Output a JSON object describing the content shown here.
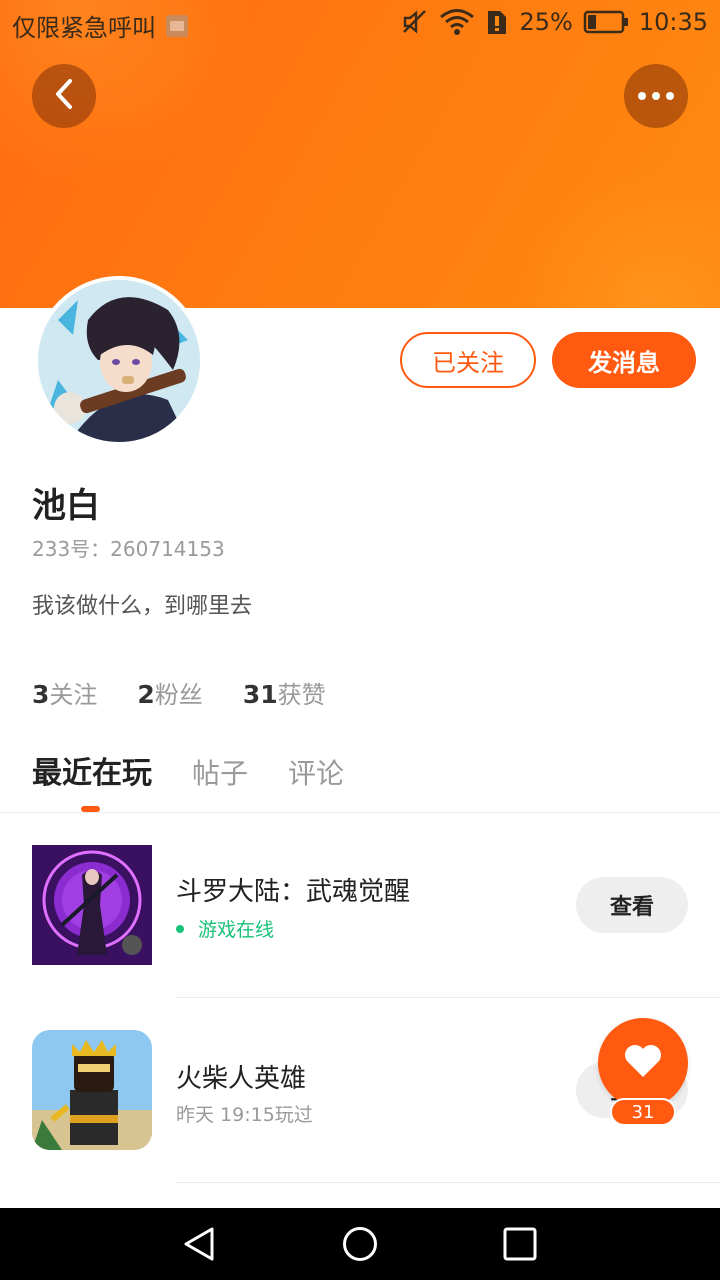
{
  "status_bar": {
    "carrier_text": "仅限紧急呼叫",
    "battery_percent": "25%",
    "time": "10:35",
    "battery_level": 0.25
  },
  "header": {
    "back_icon": "chevron-left-icon",
    "more_icon": "more-dots-icon",
    "accent_color": "#ff5a10"
  },
  "profile": {
    "name": "池白",
    "uid": "233号：260714153",
    "bio": "我该做什么，到哪里去",
    "follow_label": "已关注",
    "message_label": "发消息"
  },
  "stats": [
    {
      "count": "3",
      "label": "关注"
    },
    {
      "count": "2",
      "label": "粉丝"
    },
    {
      "count": "31",
      "label": "获赞"
    }
  ],
  "tabs": [
    {
      "label": "最近在玩",
      "active": true
    },
    {
      "label": "帖子",
      "active": false
    },
    {
      "label": "评论",
      "active": false
    }
  ],
  "games": [
    {
      "title": "斗罗大陆：武魂觉醒",
      "status": "游戏在线",
      "status_color": "#19c37a",
      "button": "查看"
    },
    {
      "title": "火柴人英雄",
      "status": "昨天 19:15玩过",
      "status_color": "#9a9a9a",
      "button": "查看"
    }
  ],
  "like": {
    "count": "31",
    "icon": "heart-icon"
  },
  "navbar": {
    "back_icon": "nav-back-icon",
    "home_icon": "nav-home-icon",
    "recents_icon": "nav-recents-icon"
  }
}
